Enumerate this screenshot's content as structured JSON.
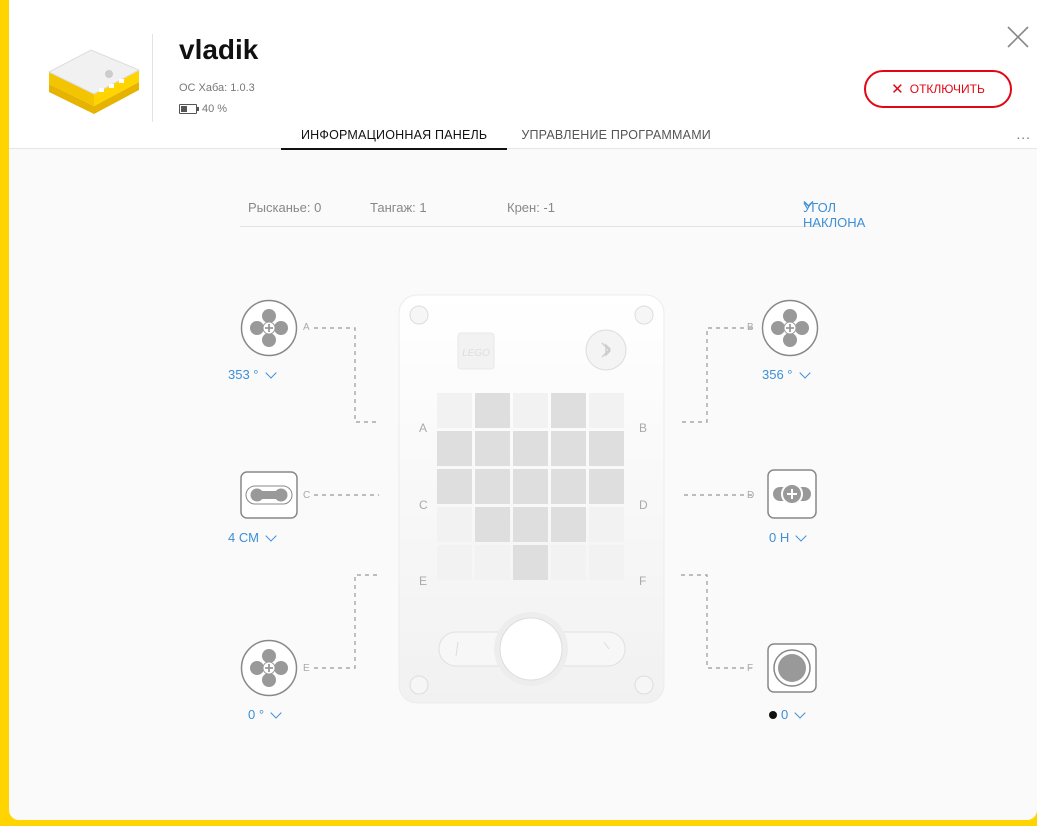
{
  "hub": {
    "name": "vladik",
    "os_version": "ОС Хаба: 1.0.3",
    "battery_level": "40 %",
    "battery_fraction": 0.4
  },
  "header": {
    "disconnect_label": "ОТКЛЮЧИТЬ",
    "more_label": "..."
  },
  "tabs": [
    {
      "label": "ИНФОРМАЦИОННАЯ ПАНЕЛЬ",
      "active": true
    },
    {
      "label": "УПРАВЛЕНИЕ ПРОГРАММАМИ",
      "active": false
    }
  ],
  "orientation": {
    "yaw": "Рысканье: 0",
    "pitch": "Тангаж: 1",
    "roll": "Крен: -1",
    "mode": "УГОЛ НАКЛОНА"
  },
  "ports": {
    "A": {
      "label": "A",
      "value": "353 °",
      "device": "motor-icon"
    },
    "B": {
      "label": "B",
      "value": "356 °",
      "device": "motor-icon"
    },
    "C": {
      "label": "C",
      "value": "4 СМ",
      "device": "distance-sensor-icon"
    },
    "D": {
      "label": "D",
      "value": "0 Н",
      "device": "force-sensor-icon"
    },
    "E": {
      "label": "E",
      "value": "0 °",
      "device": "motor-icon"
    },
    "F": {
      "label": "F",
      "value": "0",
      "device": "button-sensor-icon"
    }
  },
  "hub_ports": {
    "a": "A",
    "b": "B",
    "c": "C",
    "d": "D",
    "e": "E",
    "f": "F"
  },
  "logo_text": "LEGO",
  "colors": {
    "accent": "#3d8fd6",
    "danger": "#e30613",
    "frame": "#ffd400"
  },
  "matrix": [
    [
      0,
      1,
      0,
      1,
      0
    ],
    [
      1,
      1,
      1,
      1,
      1
    ],
    [
      1,
      1,
      1,
      1,
      1
    ],
    [
      0,
      1,
      1,
      1,
      0
    ],
    [
      0,
      0,
      1,
      0,
      0
    ]
  ]
}
